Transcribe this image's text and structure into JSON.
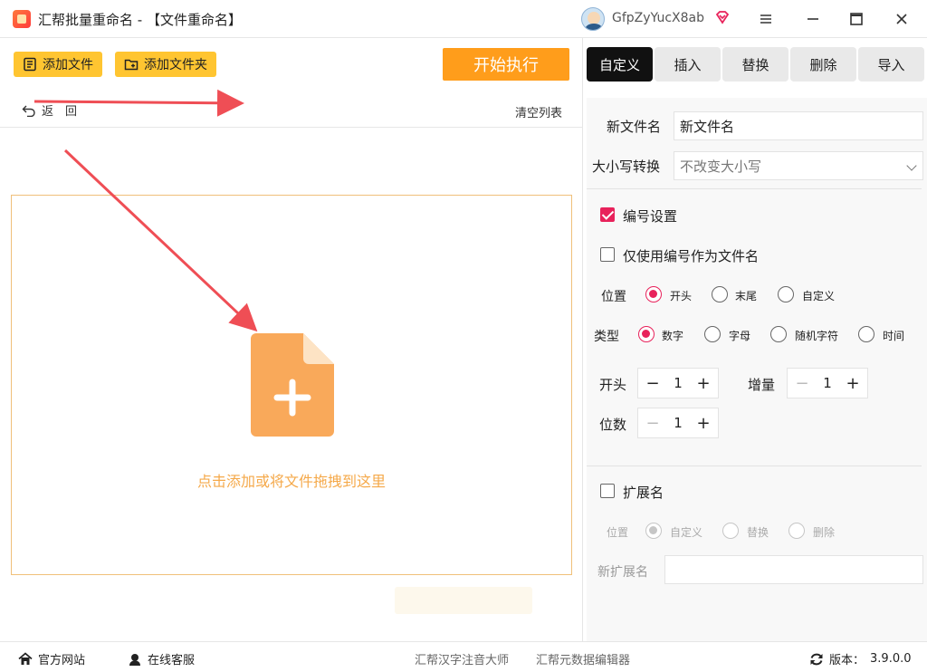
{
  "titlebar": {
    "title": "汇帮批量重命名 - 【文件重命名】",
    "user": "GfpZyYucX8ab",
    "minimize_icon": "hamburger-menu",
    "maximize_icon": "square",
    "close_icon": "×"
  },
  "toolbar": {
    "add_file": "添加文件",
    "add_folder": "添加文件夹",
    "start": "开始执行",
    "back": "返　回",
    "clear_list": "清空列表"
  },
  "dropzone": {
    "text": "点击添加或将文件拖拽到这里",
    "accent": "#f5a94a"
  },
  "tabs": [
    {
      "label": "自定义",
      "active": true
    },
    {
      "label": "插入",
      "active": false
    },
    {
      "label": "替换",
      "active": false
    },
    {
      "label": "删除",
      "active": false
    },
    {
      "label": "导入",
      "active": false
    }
  ],
  "panel": {
    "new_name_label": "新文件名",
    "new_name_value": "新文件名",
    "case_label": "大小写转换",
    "case_value": "不改变大小写",
    "numbering": {
      "label": "编号设置",
      "checked": true,
      "only_number_label": "仅使用编号作为文件名",
      "only_number_checked": false,
      "position_label": "位置",
      "position_options": [
        "开头",
        "末尾",
        "自定义"
      ],
      "position_selected": "开头",
      "type_label": "类型",
      "type_options": [
        "数字",
        "字母",
        "随机字符",
        "时间"
      ],
      "type_selected": "数字",
      "start_label": "开头",
      "start_value": "1",
      "increment_label": "增量",
      "increment_value": "1",
      "digits_label": "位数",
      "digits_value": "1"
    },
    "extension": {
      "label": "扩展名",
      "checked": false,
      "position_label": "位置",
      "options": [
        "自定义",
        "替换",
        "删除"
      ],
      "selected": "自定义",
      "new_ext_label": "新扩展名",
      "new_ext_value": ""
    }
  },
  "footer": {
    "website": "官方网站",
    "support": "在线客服",
    "link1": "汇帮汉字注音大师",
    "link2": "汇帮元数据编辑器",
    "version_label": "版本：",
    "version": "3.9.0.0"
  },
  "colors": {
    "accent_yellow": "#ffc531",
    "start_orange": "#ff9d1b",
    "check_red": "#e8225b",
    "arrow_red": "#ef4e55"
  }
}
